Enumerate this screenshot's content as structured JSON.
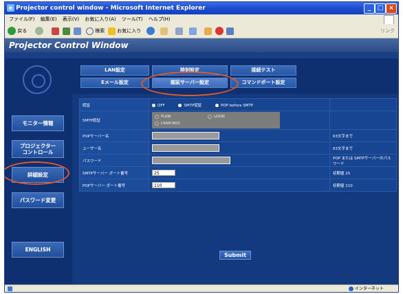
{
  "window": {
    "title": "Projector control window - Microsoft Internet Explorer"
  },
  "menubar": {
    "items": [
      "ファイル(F)",
      "編集(E)",
      "表示(V)",
      "お気に入り(A)",
      "ツール(T)",
      "ヘルプ(H)"
    ]
  },
  "toolbar": {
    "back_label": "戻る",
    "search_label": "検索",
    "favorites_label": "お気に入り",
    "links_label": "リンク"
  },
  "app": {
    "title": "Projector Control Window"
  },
  "sidebar": {
    "items": [
      {
        "label": "モニター情報"
      },
      {
        "label": "プロジェクター\nコントロール"
      },
      {
        "label": "詳細設定"
      },
      {
        "label": "パスワード変更"
      },
      {
        "label": "ENGLISH"
      }
    ]
  },
  "tabs": {
    "row1": [
      "LAN設定",
      "時刻設定",
      "接続テスト"
    ],
    "row2": [
      "Eメール設定",
      "認証サーバー設定",
      "コマンドポート設定"
    ],
    "active": "認証サーバー設定"
  },
  "form": {
    "auth": {
      "label": "認証",
      "options": [
        "OFF",
        "SMTP認証",
        "POP before SMTP"
      ]
    },
    "smtp_auth": {
      "label": "SMTP認証",
      "options": [
        "PLAIN",
        "LOGIN",
        "CRAM-MD5"
      ]
    },
    "pop_server": {
      "label": "POPサーバー名",
      "note": "63文字まで"
    },
    "user_name": {
      "label": "ユーザー名",
      "note": "63文字まで"
    },
    "password": {
      "label": "パスワード",
      "note": "POP または SMTPサーバーのパスワード"
    },
    "smtp_port": {
      "label": "SMTPサーバー ポート番号",
      "value": "25",
      "note": "初期値 25"
    },
    "pop_port": {
      "label": "POPサーバー ポート番号",
      "value": "110",
      "note": "初期値 110"
    }
  },
  "submit_label": "Submit",
  "status": {
    "zone": "インターネット"
  },
  "colors": {
    "highlight": "#e05a28",
    "accent": "#1f4fd0"
  }
}
